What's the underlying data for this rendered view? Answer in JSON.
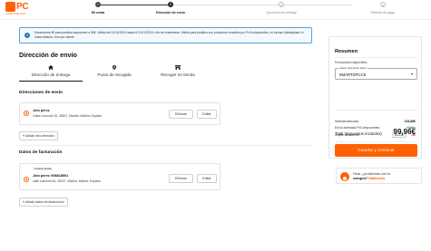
{
  "brand": {
    "logo_text": "PC",
    "logo_sub": "COMPONENTES"
  },
  "steps": [
    {
      "label": "Mi cesta",
      "state": "done",
      "number": ""
    },
    {
      "label": "Dirección de envío",
      "state": "active",
      "number": "2"
    },
    {
      "label": "Opciones de entrega",
      "state": "todo",
      "number": "3"
    },
    {
      "label": "Método de pago",
      "state": "todo",
      "number": "4"
    }
  ],
  "banner": {
    "icon": "info-icon",
    "text": "Descuentos 9€ para pedidos superiores a 99€. Válido del 01/11/2024 hasta el 31/12/2024 o fin de existencias. Válido para pedidos con productos vendidos por PcComponentes, no incluye Marketplace ni Gama Básica. Uno por cliente."
  },
  "page_title": "Dirección de envío",
  "tabs": [
    {
      "label": "Dirección de entrega",
      "icon": "home-icon",
      "active": true
    },
    {
      "label": "Punto de recogida",
      "icon": "location-pin-icon",
      "active": false
    },
    {
      "label": "Recoger en tienda",
      "icon": "store-icon",
      "active": false
    }
  ],
  "shipping": {
    "heading": "Direcciones de envío",
    "address": {
      "name": "Jolo perez",
      "line": "Calee cuvencit 45, 28007, Madrid, Madrid, España"
    },
    "delete_label": "Eliminar",
    "edit_label": "Editar",
    "add_label": "Añadir otra dirección"
  },
  "billing": {
    "heading": "Datos de facturación",
    "tag": "Predeterminada",
    "name": "Jolo perez X58818501",
    "line": "calle cuevenit 45, 28007, Madrid, Madrid, España",
    "delete_label": "Eliminar",
    "edit_label": "Editar",
    "add_label": "Añadir datos de facturación"
  },
  "summary": {
    "title": "Resumen",
    "promo_label": "Promociones disponibles",
    "promo_field_legend": "Cupón descuento activo",
    "promo_value": "9MARTZPCC5",
    "rows": [
      {
        "label": "Subtotal artículos",
        "value": "104,86€",
        "style": "normal"
      },
      {
        "label": "Envío estimado PcComponentes",
        "value": "Gratis",
        "style": "green"
      },
      {
        "label": "Cupón descuento",
        "value": "-9€",
        "style": "red"
      }
    ],
    "remove_label": "Eliminar",
    "total_label": "Total (impuestos incluidos)",
    "total_value": "99,96€",
    "cta_label": "Guardar y continuar"
  },
  "help": {
    "line1": "Hola, ¿problemas con tu",
    "line2_prefix": "compra?",
    "line2_brand": "Hablemos"
  },
  "colors": {
    "accent": "#ff6000",
    "info": "#2377c2",
    "success": "#2a8a2a",
    "danger": "#dd2222"
  }
}
